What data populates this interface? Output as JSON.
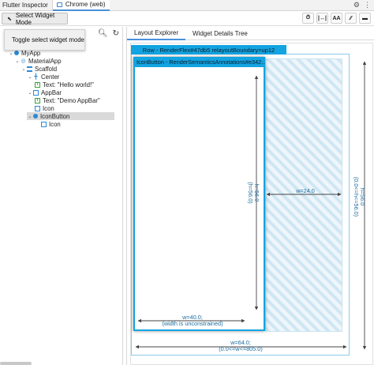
{
  "tabs": {
    "inspector_label": "Flutter Inspector",
    "chrome_label": "Chrome (web)"
  },
  "toolbar": {
    "select_widget_mode_label": "Select Widget Mode",
    "tooltip": "Toggle select widget mode",
    "buttons": [
      "⏱",
      "|↔|",
      "AA",
      "⁄⁄",
      "▬"
    ]
  },
  "tree": [
    {
      "label": "MyApp",
      "icon": "widget-dot-icon"
    },
    {
      "label": "MaterialApp",
      "icon": "material-app-icon"
    },
    {
      "label": "Scaffold",
      "icon": "scaffold-icon"
    },
    {
      "label": "Center",
      "icon": "center-icon"
    },
    {
      "label": "Text: \"Hello world!\"",
      "icon": "text-icon"
    },
    {
      "label": "AppBar",
      "icon": "container-icon"
    },
    {
      "label": "Text: \"Demo AppBar\"",
      "icon": "text-icon"
    },
    {
      "label": "Icon",
      "icon": "container-icon"
    },
    {
      "label": "IconButton",
      "icon": "widget-dot-icon"
    },
    {
      "label": "Icon",
      "icon": "container-icon"
    }
  ],
  "right": {
    "tab_layout_explorer": "Layout Explorer",
    "tab_widget_details": "Widget Details Tree",
    "row_header": "Row - RenderFlex#47db5 relayoutBoundary=up12",
    "iconbutton_header": "IconButton - RenderSemanticsAnnotations#e342…",
    "h_inner": "h=56.0",
    "h_inner_sub": "(h=56.0)",
    "w_inner": "w=40.0;",
    "w_inner_sub": "(width is unconstrained)",
    "w_space": "w=24.0",
    "h_outer": "h=56.0",
    "h_outer_sub": "(0.0<=h<=56.0)",
    "w_outer": "w=64.0;",
    "w_outer_sub": "(0.0<=w<=805.0)"
  },
  "colors": {
    "accent": "#13a4e1",
    "hatch": "#cfe6f3",
    "label": "#1c6c9c",
    "arrow": "#444444"
  }
}
